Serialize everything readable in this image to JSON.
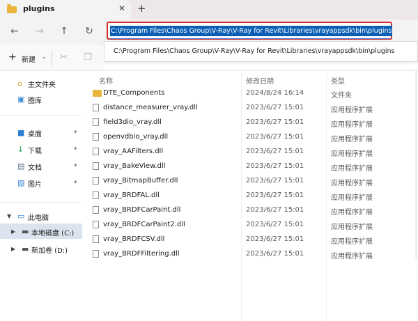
{
  "tab": {
    "title": "plugins",
    "close": "✕",
    "add": "+"
  },
  "nav": {
    "back": "←",
    "forward": "→",
    "up": "↑",
    "refresh": "↻"
  },
  "address": {
    "value": "C:\\Program Files\\Chaos Group\\V-Ray\\V-Ray for Revit\\Libraries\\vrayappsdk\\bin\\plugins",
    "suggestion": "C:\\Program Files\\Chaos Group\\V-Ray\\V-Ray for Revit\\Libraries\\vrayappsdk\\bin\\plugins"
  },
  "toolbar": {
    "new_label": "新建",
    "new_icon": "+",
    "chevron": "⌄"
  },
  "sidebar": {
    "items": [
      {
        "label": "主文件夹",
        "icon": "⌂"
      },
      {
        "label": "图库",
        "icon": "▣"
      },
      {
        "label": "桌面",
        "icon": "■",
        "pinned": "📌"
      },
      {
        "label": "下载",
        "icon": "↓",
        "pinned": "📌"
      },
      {
        "label": "文档",
        "icon": "▤",
        "pinned": "📌"
      },
      {
        "label": "图片",
        "icon": "▨",
        "pinned": "📌"
      },
      {
        "label": "此电脑",
        "icon": "▭"
      },
      {
        "label": "本地磁盘 (C:)",
        "icon": "▬"
      },
      {
        "label": "新加卷 (D:)",
        "icon": "▬"
      }
    ]
  },
  "columns": {
    "name": "名称",
    "modified": "修改日期",
    "type": "类型"
  },
  "files": [
    {
      "name": "DTE_Components",
      "modified": "2024/8/24 16:14",
      "type": "文件夹"
    },
    {
      "name": "distance_measurer_vray.dll",
      "modified": "2023/6/27 15:01",
      "type": "应用程序扩展"
    },
    {
      "name": "field3dio_vray.dll",
      "modified": "2023/6/27 15:01",
      "type": "应用程序扩展"
    },
    {
      "name": "openvdbio_vray.dll",
      "modified": "2023/6/27 15:01",
      "type": "应用程序扩展"
    },
    {
      "name": "vray_AAFilters.dll",
      "modified": "2023/6/27 15:01",
      "type": "应用程序扩展"
    },
    {
      "name": "vray_BakeView.dll",
      "modified": "2023/6/27 15:01",
      "type": "应用程序扩展"
    },
    {
      "name": "vray_BitmapBuffer.dll",
      "modified": "2023/6/27 15:01",
      "type": "应用程序扩展"
    },
    {
      "name": "vray_BRDFAL.dll",
      "modified": "2023/6/27 15:01",
      "type": "应用程序扩展"
    },
    {
      "name": "vray_BRDFCarPaint.dll",
      "modified": "2023/6/27 15:01",
      "type": "应用程序扩展"
    },
    {
      "name": "vray_BRDFCarPaint2.dll",
      "modified": "2023/6/27 15:01",
      "type": "应用程序扩展"
    },
    {
      "name": "vray_BRDFCSV.dll",
      "modified": "2023/6/27 15:01",
      "type": "应用程序扩展"
    },
    {
      "name": "vray_BRDFFiltering.dll",
      "modified": "2023/6/27 15:01",
      "type": "应用程序扩展"
    }
  ],
  "colors": {
    "selection": "#0a5fb4",
    "highlight_border": "#d32f2f",
    "folder": "#e9b53c"
  }
}
